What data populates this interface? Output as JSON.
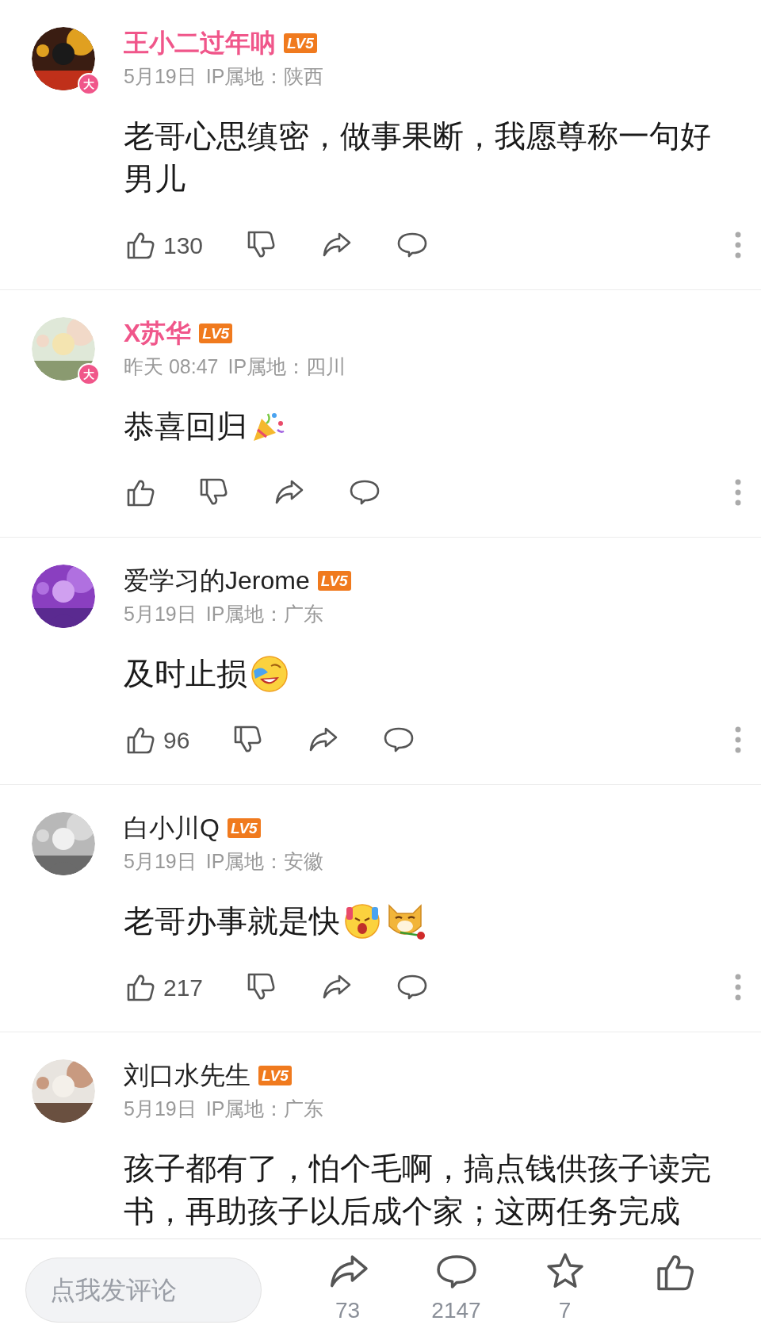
{
  "comments": [
    {
      "user": "王小二过年呐",
      "vip": true,
      "level_badge": "LV5",
      "avatar_badge": "大",
      "date": "5月19日",
      "ip": "IP属地：陕西",
      "text": "老哥心思缜密，做事果断，我愿尊称一句好男儿",
      "likes": "130"
    },
    {
      "user": "X苏华",
      "vip": true,
      "level_badge": "LV5",
      "avatar_badge": "大",
      "date": "昨天 08:47",
      "ip": "IP属地：四川",
      "text": "恭喜回归",
      "emojis": [
        {
          "kind": "party"
        }
      ]
    },
    {
      "user": "爱学习的Jerome",
      "vip": false,
      "level_badge": "LV5",
      "date": "5月19日",
      "ip": "IP属地：广东",
      "text": "及时止损",
      "emojis": [
        {
          "kind": "laugh"
        }
      ],
      "likes": "96"
    },
    {
      "user": "白小川Q",
      "vip": false,
      "level_badge": "LV5",
      "date": "5月19日",
      "ip": "IP属地：安徽",
      "text": "老哥办事就是快",
      "emojis": [
        {
          "kind": "shock"
        },
        {
          "kind": "dog"
        }
      ],
      "likes": "217"
    },
    {
      "user": "刘口水先生",
      "vip": false,
      "level_badge": "LV5",
      "date": "5月19日",
      "ip": "IP属地：广东",
      "text": "孩子都有了，怕个毛啊，搞点钱供孩子读完书，再助孩子以后成个家；这两任务完成"
    }
  ],
  "bottom_bar": {
    "placeholder": "点我发评论",
    "actions": [
      {
        "kind": "share",
        "count": "73"
      },
      {
        "kind": "comment",
        "count": "2147"
      },
      {
        "kind": "star",
        "count": "7"
      },
      {
        "kind": "like"
      }
    ]
  }
}
